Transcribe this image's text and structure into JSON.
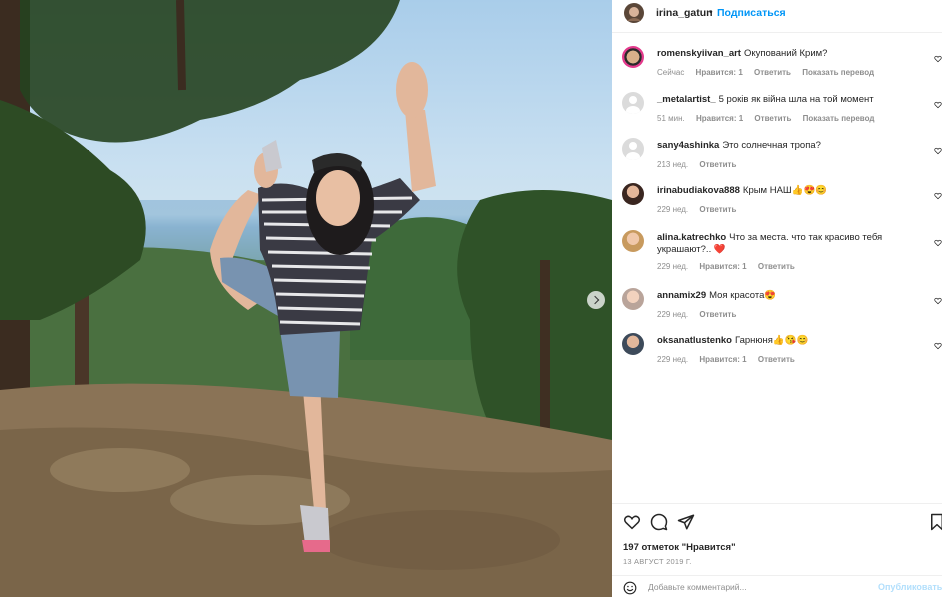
{
  "post": {
    "author": "irina_gatun",
    "separator": "•",
    "follow_label": "Подписаться",
    "likes_text": "197 отметок \"Нравится\"",
    "date_text": "13 АВГУСТ 2019 Г.",
    "add_comment_placeholder": "Добавьте комментарий...",
    "post_label": "Опубликовать"
  },
  "comments": [
    {
      "user": "romenskyiivan_art",
      "text": "Окупований Крим?",
      "meta": [
        "Сейчас",
        "Нравится: 1",
        "Ответить",
        "Показать перевод"
      ],
      "avatar": "art-avatar"
    },
    {
      "user": "_metalartist_",
      "text": "5 років як війна шла на той момент",
      "meta": [
        "51 мин.",
        "Нравится: 1",
        "Ответить",
        "Показать перевод"
      ],
      "avatar": "default-avatar"
    },
    {
      "user": "sany4ashinka",
      "text": "Это солнечная тропа?",
      "meta": [
        "213 нед.",
        "Ответить"
      ],
      "avatar": "default-avatar"
    },
    {
      "user": "irinabudiakova888",
      "text": "Крым НАШ👍😍😊",
      "meta": [
        "229 нед.",
        "Ответить"
      ],
      "avatar": "photo-avatar"
    },
    {
      "user": "alina.katrechko",
      "text": "Что за места. что так красиво тебя украшают?.. ❤️",
      "meta": [
        "229 нед.",
        "Нравится: 1",
        "Ответить"
      ],
      "avatar": "photo-avatar"
    },
    {
      "user": "annamix29",
      "text": "Моя красота😍",
      "meta": [
        "229 нед.",
        "Ответить"
      ],
      "avatar": "photo-avatar"
    },
    {
      "user": "oksanatlustenko",
      "text": "Гарнюня👍😘😊",
      "meta": [
        "229 нед.",
        "Нравится: 1",
        "Ответить"
      ],
      "avatar": "photo-avatar"
    }
  ],
  "icons": {
    "like": "heart-icon",
    "comment": "comment-bubble-icon",
    "share": "paper-plane-icon",
    "save": "bookmark-icon",
    "emoji": "emoji-smile-icon",
    "next": "chevron-right-icon"
  },
  "colors": {
    "accent": "#0095f6",
    "muted": "#8e8e8e",
    "text": "#262626",
    "post_disabled": "#b2dffc"
  }
}
